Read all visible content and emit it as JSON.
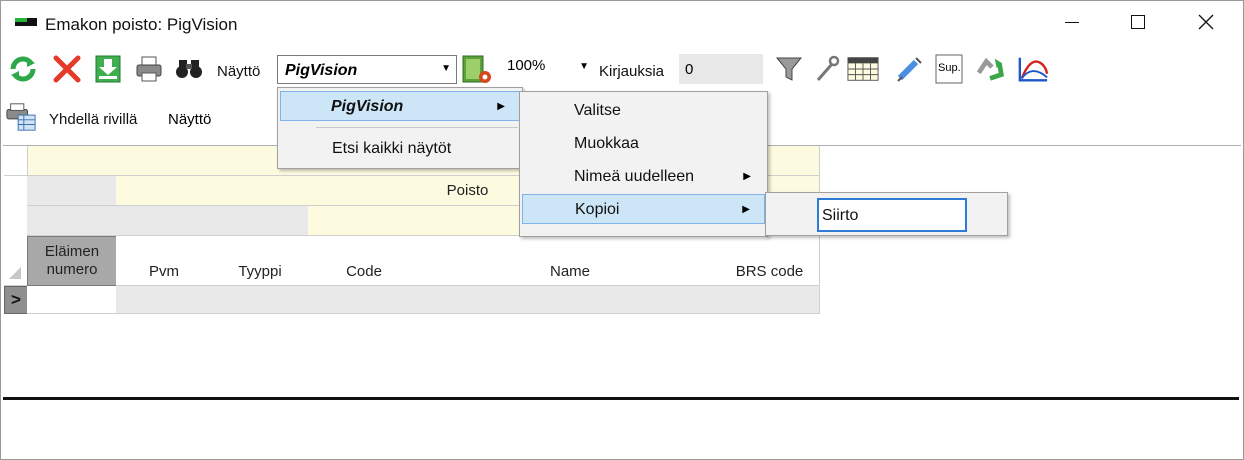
{
  "window": {
    "title": "Emakon poisto: PigVision"
  },
  "toolbar": {
    "icons": [
      "refresh-icon",
      "delete-icon",
      "download-icon",
      "print-icon",
      "binoculars-icon",
      "screen-settings-icon",
      "filter-icon",
      "wrench-icon",
      "calendar-icon",
      "syringe-icon",
      "sup-icon",
      "recycle-icon",
      "curve-chart-icon"
    ],
    "view_label": "Näyttö",
    "view_value": "PigVision",
    "zoom_value": "100%",
    "records_label": "Kirjauksia",
    "records_value": "0",
    "sup_text": "Sup."
  },
  "toolbar2": {
    "one_row_label": "Yhdellä rivillä",
    "view_value": "Näyttö"
  },
  "grid": {
    "group_header": "Poisto",
    "columns": [
      "Eläimen numero",
      "Pvm",
      "Tyyppi",
      "Code",
      "Name",
      "BRS code"
    ],
    "row_indicator": ">"
  },
  "menus": {
    "view_menu": {
      "items": [
        "PigVision",
        "Etsi kaikki näytöt"
      ],
      "highlighted": "PigVision"
    },
    "pigvision_submenu": {
      "items": [
        "Valitse",
        "Muokkaa",
        "Nimeä uudelleen",
        "Kopioi"
      ],
      "highlighted": "Kopioi"
    },
    "copy_name_input": {
      "value": "Siirto"
    }
  },
  "colors": {
    "grid_yellow": "#fdfbdf",
    "menu_highlight": "#cde6f7",
    "menu_highlight_border": "#7eb4ea",
    "input_focus": "#2e7bd6"
  }
}
